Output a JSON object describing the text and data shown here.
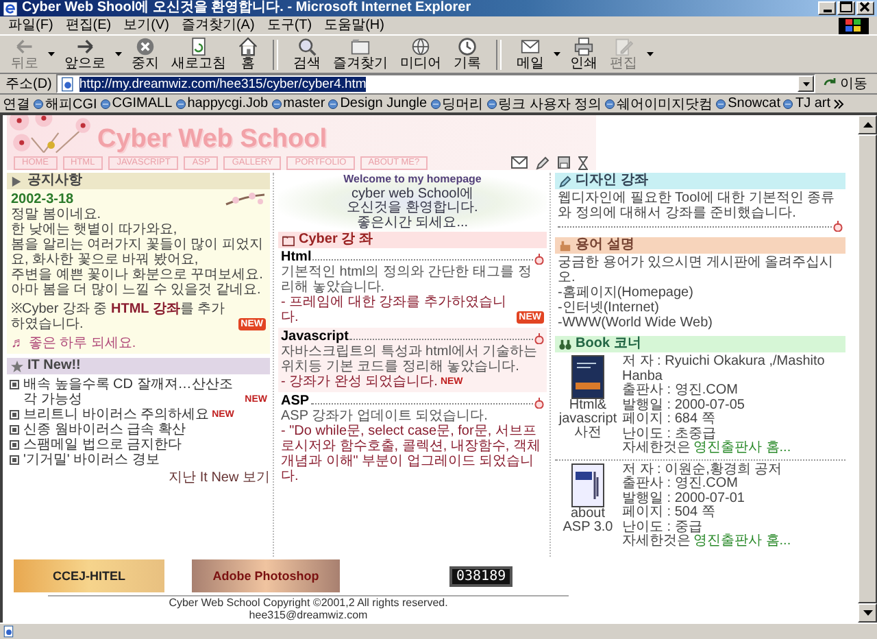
{
  "window": {
    "title": "Cyber Web Shool에 오신것을 환영합니다. - Microsoft Internet Explorer"
  },
  "menu": [
    "파일(F)",
    "편집(E)",
    "보기(V)",
    "즐겨찾기(A)",
    "도구(T)",
    "도움말(H)"
  ],
  "toolbar": [
    {
      "buttons": [
        {
          "label": "뒤로",
          "kind": "back",
          "disabled": true,
          "dropdown": true
        },
        {
          "label": "앞으로",
          "kind": "forward",
          "disabled": false,
          "dropdown": true
        },
        {
          "label": "중지",
          "kind": "stop",
          "disabled": false,
          "dropdown": false
        },
        {
          "label": "새로고침",
          "kind": "refresh",
          "disabled": false,
          "dropdown": false
        },
        {
          "label": "홈",
          "kind": "home",
          "disabled": false,
          "dropdown": false
        }
      ]
    },
    {
      "buttons": [
        {
          "label": "검색",
          "kind": "search",
          "disabled": false,
          "dropdown": false
        },
        {
          "label": "즐겨찾기",
          "kind": "favorites",
          "disabled": false,
          "dropdown": false
        },
        {
          "label": "미디어",
          "kind": "media",
          "disabled": false,
          "dropdown": false
        },
        {
          "label": "기록",
          "kind": "history",
          "disabled": false,
          "dropdown": false
        }
      ]
    },
    {
      "buttons": [
        {
          "label": "메일",
          "kind": "mail",
          "disabled": false,
          "dropdown": true
        },
        {
          "label": "인쇄",
          "kind": "print",
          "disabled": false,
          "dropdown": false
        },
        {
          "label": "편집",
          "kind": "edit",
          "disabled": true,
          "dropdown": true
        }
      ]
    }
  ],
  "address": {
    "label": "주소(D)",
    "value": "http://my.dreamwiz.com/hee315/cyber/cyber4.htm",
    "go": "이동"
  },
  "links": {
    "label": "연결",
    "items": [
      "해피CGI",
      "CGIMALL",
      "happycgi.Job",
      "master",
      "Design Jungle",
      "딩머리",
      "링크 사용자 정의",
      "쉐어이미지닷컴",
      "Snowcat",
      "TJ art"
    ]
  },
  "site": {
    "title": "Cyber Web School",
    "nav": [
      "HOME",
      "HTML",
      "JAVASCRIPT",
      "ASP",
      "GALLERY",
      "PORTFOLIO",
      "ABOUT ME?"
    ]
  },
  "notice": {
    "title": "공지사항",
    "date": "2002-3-18",
    "lines": [
      "정말 봄이네요.",
      "한 낮에는 햇볕이 따가와요,",
      "봄을 알리는 여러가지 꽃들이 많이 피었지요, 화사한 꽃으로 바꿔 봤어요,",
      "주변을 예쁜 꽃이나 화분으로 꾸며보세요.",
      "아마 봄을 더 많이 느낄 수 있을것 같네요."
    ],
    "update": "※Cyber 강좌 중 **HTML 강좌**를 추가 하였습니다.",
    "update_badge": {
      "text": "NEW",
      "kind": "box"
    },
    "greeting": "♬ 좋은 하루 되세요."
  },
  "it_news": {
    "title": "IT New!!",
    "items": [
      {
        "text": "배속 높을수록 CD 잘깨져…산산조각 가능성",
        "badge": {
          "text": "NEW",
          "kind": "text"
        }
      },
      {
        "text": "브리트니 바이러스 주의하세요",
        "badge": {
          "text": "NEW",
          "kind": "text"
        }
      },
      {
        "text": "신종 웜바이러스 급속 확산"
      },
      {
        "text": "스팸메일 법으로 금지한다"
      },
      {
        "text": "'기거밀' 바이러스 경보"
      }
    ],
    "more": "지난 It New 보기"
  },
  "welcome": [
    "Welcome to my homepage",
    "cyber web School에",
    "오신것을 환영합니다.",
    "좋은시간 되세요..."
  ],
  "cyber_course": {
    "title": "Cyber 강 좌",
    "items": [
      {
        "name": "Html",
        "description": "기본적인 html의 정의와 간단한 태그를 정리해 놓았습니다.",
        "note": "- 프레임에 대한 강좌를 추가하였습니다.",
        "badge": {
          "text": "NEW",
          "kind": "box"
        },
        "shaded": false
      },
      {
        "name": "Javascript",
        "description": "자바스크립트의 특성과 html에서 기술하는 위치등 기본 코드를 정리해 놓았습니다.",
        "note": "- 강좌가 완성 되었습니다.",
        "badge": {
          "text": "NEW",
          "kind": "text"
        },
        "shaded": true
      },
      {
        "name": "ASP",
        "description": "ASP 강좌가 업데이트 되었습니다.",
        "note": "- \"Do while문, select case문, for문, 서브프로시저와 함수호출, 콜렉션, 내장함수, 객체개념과 이해\" 부분이 업그레이드 되었습니다.",
        "shaded": false
      }
    ]
  },
  "design_course": {
    "title": "디자인 강좌",
    "text": "웹디자인에 필요한 Tool에 대한 기본적인 종류와 정의에 대해서 강좌를 준비했습니다."
  },
  "glossary": {
    "title": "용어 설명",
    "text": "궁금한 용어가 있으시면 게시판에 올려주십시오.",
    "items": [
      "-홈페이지(Homepage)",
      "-인터넷(Internet)",
      "-WWW(World Wide Web)"
    ]
  },
  "books": {
    "title": "Book 코너",
    "items": [
      {
        "caption": "Html& javascript 사전",
        "details": [
          "저 자 : Ryuichi Okakura ,/Mashito Hanba",
          "출판사 : 영진.COM",
          "발행일 : 2000-07-05",
          "페이지 : 684 쪽",
          "난이도 : 초중급"
        ],
        "more": "자세한것은",
        "link": "영진출판사 홈..."
      },
      {
        "caption": "about ASP 3.0",
        "details": [
          "저 자 : 이원순,황경희 공저",
          "출판사 : 영진.COM",
          "발행일 : 2000-07-01",
          "페이지 : 504 쪽",
          "난이도 : 중급"
        ],
        "more": "자세한것은",
        "link": "영진출판사 홈..."
      }
    ]
  },
  "banners": [
    "CCEJ-HITEL",
    "Adobe Photoshop"
  ],
  "counter": "038189",
  "footer": {
    "copyright": "Cyber Web School Copyright ©2001,2 All rights reserved.",
    "email": "hee315@dreamwiz.com"
  }
}
